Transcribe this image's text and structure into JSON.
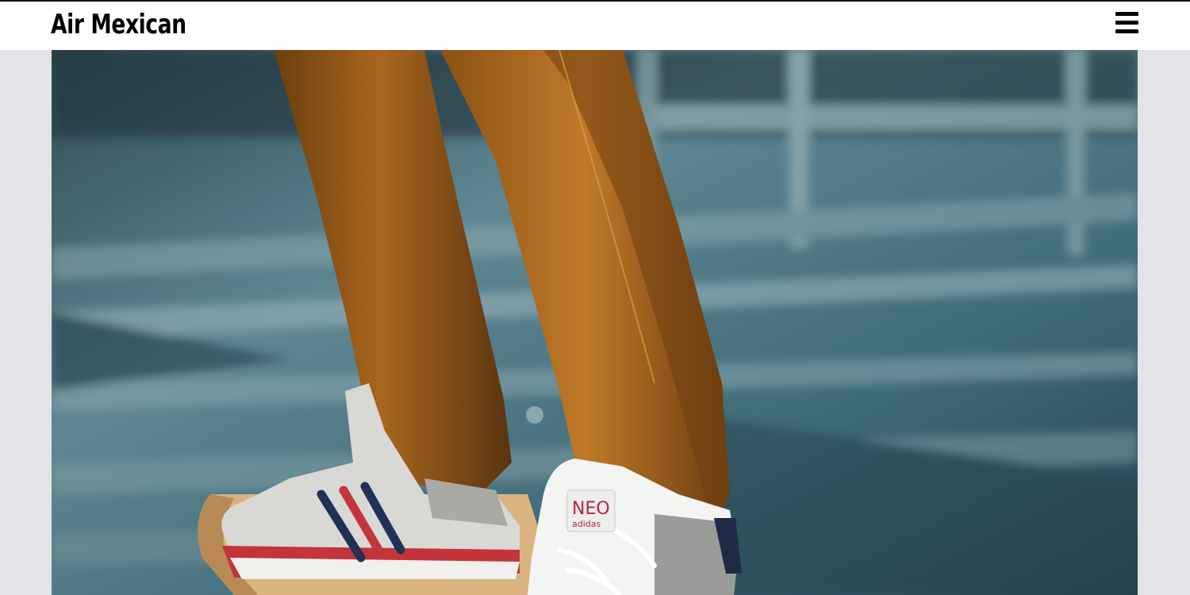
{
  "header": {
    "brand": "Air Mexican",
    "menu_icon": "hamburger-menu-icon"
  },
  "hero": {
    "image_subject": "skateboarder-sneakers-photo",
    "shoe_label_line1": "NEO",
    "shoe_label_line2": "adidas"
  },
  "colors": {
    "header_bg": "#ffffff",
    "page_bg": "#e2e3e6",
    "brand_text": "#000000"
  }
}
